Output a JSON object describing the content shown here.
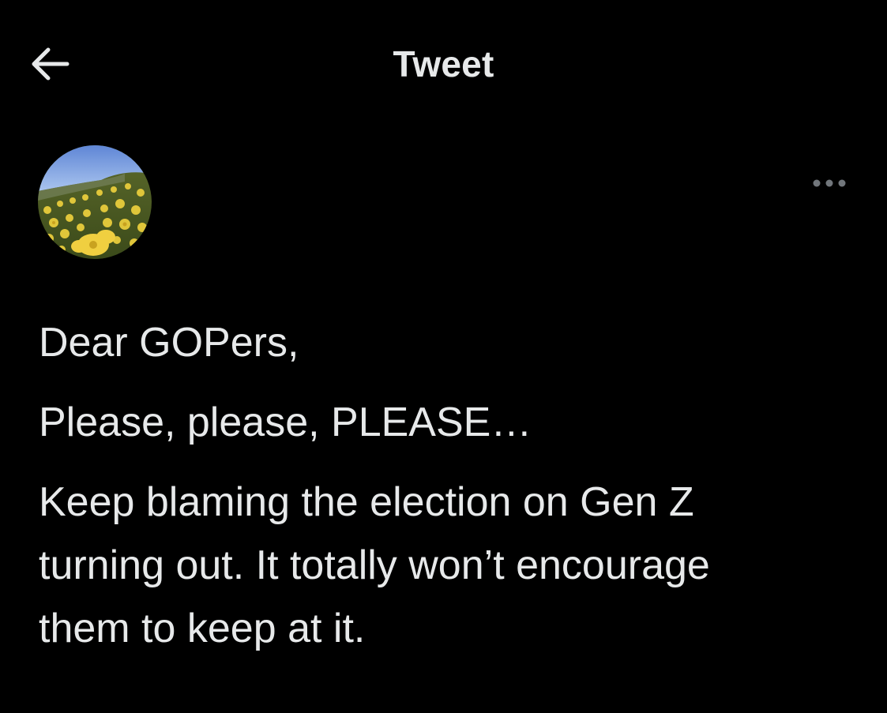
{
  "header": {
    "title": "Tweet",
    "back_icon": "arrow-left-icon"
  },
  "author": {
    "avatar_description_icon": "avatar-flower-field-icon",
    "name": "",
    "handle": ""
  },
  "more_menu_icon": "more-horizontal-icon",
  "tweet": {
    "paragraphs": [
      "Dear GOPers,",
      "Please, please, PLEASE…",
      "Keep blaming the election on Gen Z\nturning out. It totally won’t encourage\nthem to keep at it."
    ]
  },
  "colors": {
    "background": "#000000",
    "text": "#e7e9ea",
    "secondary": "#71767b"
  }
}
